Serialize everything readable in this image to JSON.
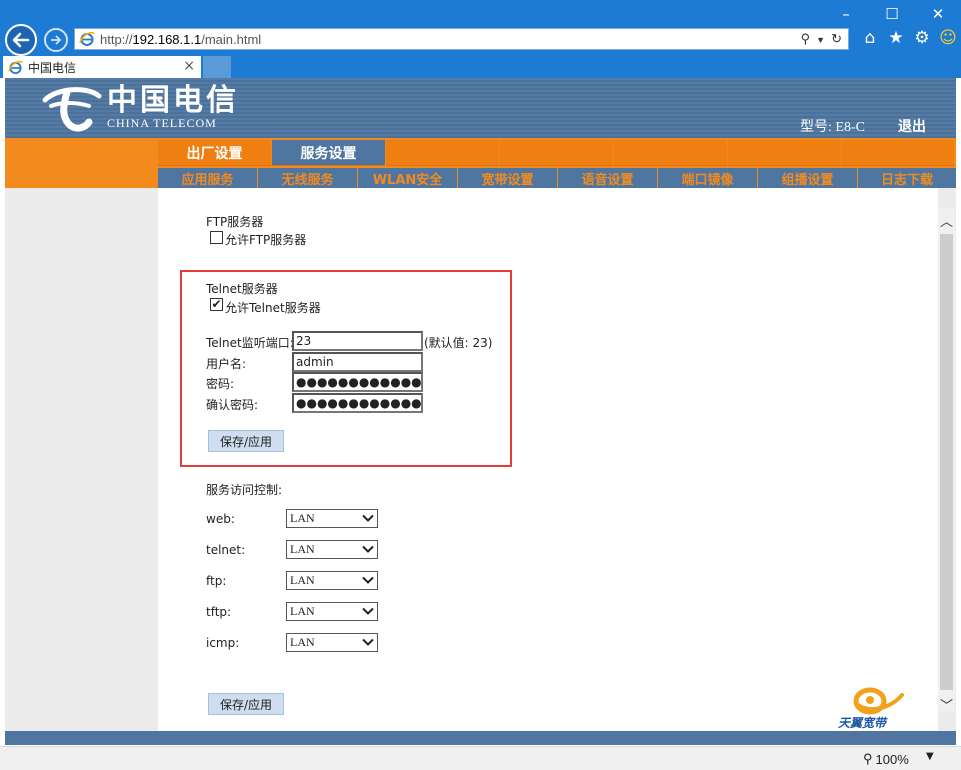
{
  "browser": {
    "url_prefix": "http://",
    "url_host": "192.168.1.1",
    "url_path": "/main.html",
    "tab_title": "中国电信",
    "zoom": "100%",
    "window_controls": [
      "–",
      "☐",
      "✕"
    ]
  },
  "header": {
    "brand_cn": "中国电信",
    "brand_en": "CHINA TELECOM",
    "model": "型号: E8-C",
    "logout": "退出"
  },
  "nav": {
    "main_tabs": [
      {
        "label": "出厂设置",
        "active": false
      },
      {
        "label": "服务设置",
        "active": true
      },
      {
        "label": "",
        "active": false
      },
      {
        "label": "",
        "active": false
      },
      {
        "label": "",
        "active": false
      },
      {
        "label": "",
        "active": false
      },
      {
        "label": "",
        "active": false
      }
    ],
    "sub_tabs": [
      "应用服务",
      "无线服务",
      "WLAN安全",
      "宽带设置",
      "语音设置",
      "端口镜像",
      "组播设置",
      "日志下载"
    ]
  },
  "ftp": {
    "title": "FTP服务器",
    "allow_label": "允许FTP服务器",
    "allow_checked": false
  },
  "telnet": {
    "title": "Telnet服务器",
    "allow_label": "允许Telnet服务器",
    "allow_checked": true,
    "port_label": "Telnet监听端口:",
    "port_value": "23",
    "port_default": "(默认值: 23)",
    "user_label": "用户名:",
    "user_value": "admin",
    "pwd_label": "密码:",
    "pwd_value": "●●●●●●●●●●●●●",
    "confirm_label": "确认密码:",
    "confirm_value": "●●●●●●●●●●●●●",
    "save_label": "保存/应用"
  },
  "access": {
    "title": "服务访问控制:",
    "rows": [
      {
        "name": "web:",
        "value": "LAN"
      },
      {
        "name": "telnet:",
        "value": "LAN"
      },
      {
        "name": "ftp:",
        "value": "LAN"
      },
      {
        "name": "tftp:",
        "value": "LAN"
      },
      {
        "name": "icmp:",
        "value": "LAN"
      }
    ],
    "save_label": "保存/应用"
  },
  "promo": {
    "text": "天翼宽带"
  },
  "colors": {
    "chrome_blue": "#1e7bd4",
    "header_blue": "#4e76a0",
    "nav_orange": "#f28a1e",
    "highlight_red": "#e23b3b",
    "button_bg": "#cfddf0"
  }
}
